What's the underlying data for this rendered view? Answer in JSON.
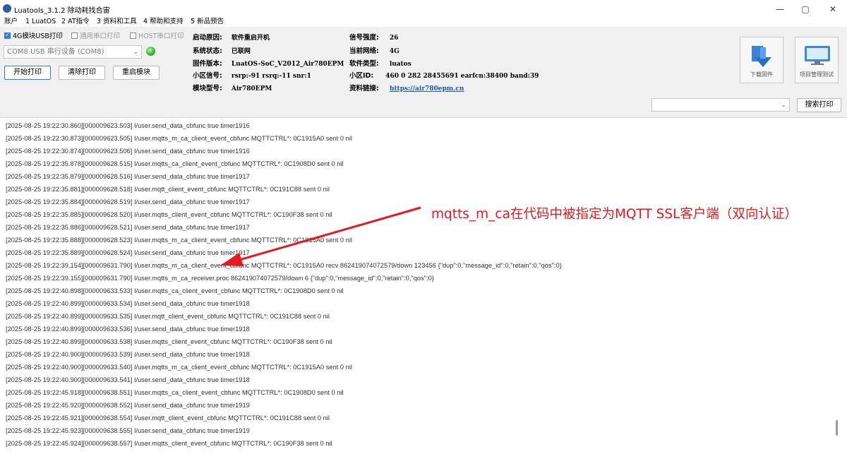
{
  "window": {
    "title": "Luatools_3.1.2 除动耗找合宙",
    "min_symbol": "—",
    "max_symbol": "▢",
    "close_symbol": "✕"
  },
  "menu": [
    "账户",
    "1 LuatOS",
    "2 AT指令",
    "3 资料和工具",
    "4 帮助和支持",
    "5 新品预告"
  ],
  "options": {
    "usb_print": "4G模块USB打印",
    "serial_print": "通用串口打印",
    "host_serial_print": "HOST串口打印"
  },
  "port_select": "COM8 USB 串行设备 (COM8)",
  "buttons": {
    "start_print": "开始打印",
    "clear_print": "清除打印",
    "restart_module": "重启模块",
    "search_print": "搜索打印"
  },
  "device_info": {
    "boot_reason_label": "启动原因:",
    "boot_reason": "软件重启开机",
    "system_status_label": "系统状态:",
    "system_status": "已联网",
    "firmware_label": "固件版本:",
    "firmware": "LuatOS-SoC_V2012_Air780EPM",
    "cell_signal_label": "小区信号:",
    "cell_signal": "rsrp:-91 rsrq:-11 snr:1",
    "model_label": "模块型号:",
    "model": "Air780EPM",
    "signal_strength_label": "信号强度:",
    "signal_strength": "26",
    "network_label": "当前网络:",
    "network": "4G",
    "software_type_label": "软件类型:",
    "software_type": "luatos",
    "cell_id_label": "小区ID:",
    "cell_id": "460 0 282 28455691 earfcn:38400 band:39",
    "docs_label": "资料链接:",
    "docs_link": "https://air780epm.cn"
  },
  "tool_buttons": {
    "download_firmware": "下载固件",
    "project_test": "项目管理测试"
  },
  "log_lines": [
    "[2025-08-25 19:22:30.860][000009623.503] I/user.send_data_cbfunc true timer1916",
    "[2025-08-25 19:22:30.873][000009623.505] I/user.mqtts_m_ca_client_event_cbfunc MQTTCTRL*: 0C1915A0 sent 0 nil",
    "[2025-08-25 19:22:30.874][000009623.506] I/user.send_data_cbfunc true timer1916",
    "[2025-08-25 19:22:35.878][000009628.515] I/user.mqtts_ca_client_event_cbfunc MQTTCTRL*: 0C1908D0 sent 0 nil",
    "[2025-08-25 19:22:35.879][000009628.516] I/user.send_data_cbfunc true timer1917",
    "[2025-08-25 19:22:35.881][000009628.518] I/user.mqtt_client_event_cbfunc MQTTCTRL*: 0C191C88 sent 0 nil",
    "[2025-08-25 19:22:35.884][000009628.519] I/user.send_data_cbfunc true timer1917",
    "[2025-08-25 19:22:35.885][000009628.520] I/user.mqtts_client_event_cbfunc MQTTCTRL*: 0C190F38 sent 0 nil",
    "[2025-08-25 19:22:35.886][000009628.521] I/user.send_data_cbfunc true timer1917",
    "[2025-08-25 19:22:35.888][000009628.523] I/user.mqtts_m_ca_client_event_cbfunc MQTTCTRL*: 0C1915A0 sent 0 nil",
    "[2025-08-25 19:22:35.889][000009628.524] I/user.send_data_cbfunc true timer1917",
    "[2025-08-25 19:22:39.154][000009631.790] I/user.mqtts_m_ca_client_event_cbfunc MQTTCTRL*: 0C1915A0 recv 862419074072579/down 123456 {\"dup\":0,\"message_id\":0,\"retain\":0,\"qos\":0}",
    "[2025-08-25 19:22:39.155][000009631.790] I/user.mqtts_m_ca_receiver.proc 862419074072579/down 6 {\"dup\":0,\"message_id\":0,\"retain\":0,\"qos\":0}",
    "[2025-08-25 19:22:40.898][000009633.533] I/user.mqtts_ca_client_event_cbfunc MQTTCTRL*: 0C1908D0 sent 0 nil",
    "[2025-08-25 19:22:40.899][000009633.534] I/user.send_data_cbfunc true timer1918",
    "[2025-08-25 19:22:40.899][000009633.535] I/user.mqtt_client_event_cbfunc MQTTCTRL*: 0C191C88 sent 0 nil",
    "[2025-08-25 19:22:40.899][000009633.536] I/user.send_data_cbfunc true timer1918",
    "[2025-08-25 19:22:40.899][000009633.538] I/user.mqtts_client_event_cbfunc MQTTCTRL*: 0C190F38 sent 0 nil",
    "[2025-08-25 19:22:40.900][000009633.539] I/user.send_data_cbfunc true timer1918",
    "[2025-08-25 19:22:40.900][000009633.540] I/user.mqtts_m_ca_client_event_cbfunc MQTTCTRL*: 0C1915A0 sent 0 nil",
    "[2025-08-25 19:22:40.900][000009633.541] I/user.send_data_cbfunc true timer1918",
    "[2025-08-25 19:22:45.918][000009638.551] I/user.mqtts_ca_client_event_cbfunc MQTTCTRL*: 0C1908D0 sent 0 nil",
    "[2025-08-25 19:22:45.920][000009638.552] I/user.send_data_cbfunc true timer1919",
    "[2025-08-25 19:22:45.921][000009638.554] I/user.mqtt_client_event_cbfunc MQTTCTRL*: 0C191C88 sent 0 nil",
    "[2025-08-25 19:22:45.923][000009638.555] I/user.send_data_cbfunc true timer1919",
    "[2025-08-25 19:22:45.924][000009638.557] I/user.mqtts_client_event_cbfunc MQTTCTRL*: 0C190F38 sent 0 nil"
  ],
  "annotation": {
    "text": "mqtts_m_ca在代码中被指定为MQTT SSL客户端（双向认证）",
    "color": "#e8181f"
  },
  "colors": {
    "link": "#1a55c9",
    "status_led": "#30b030",
    "annotation": "#e8181f"
  }
}
